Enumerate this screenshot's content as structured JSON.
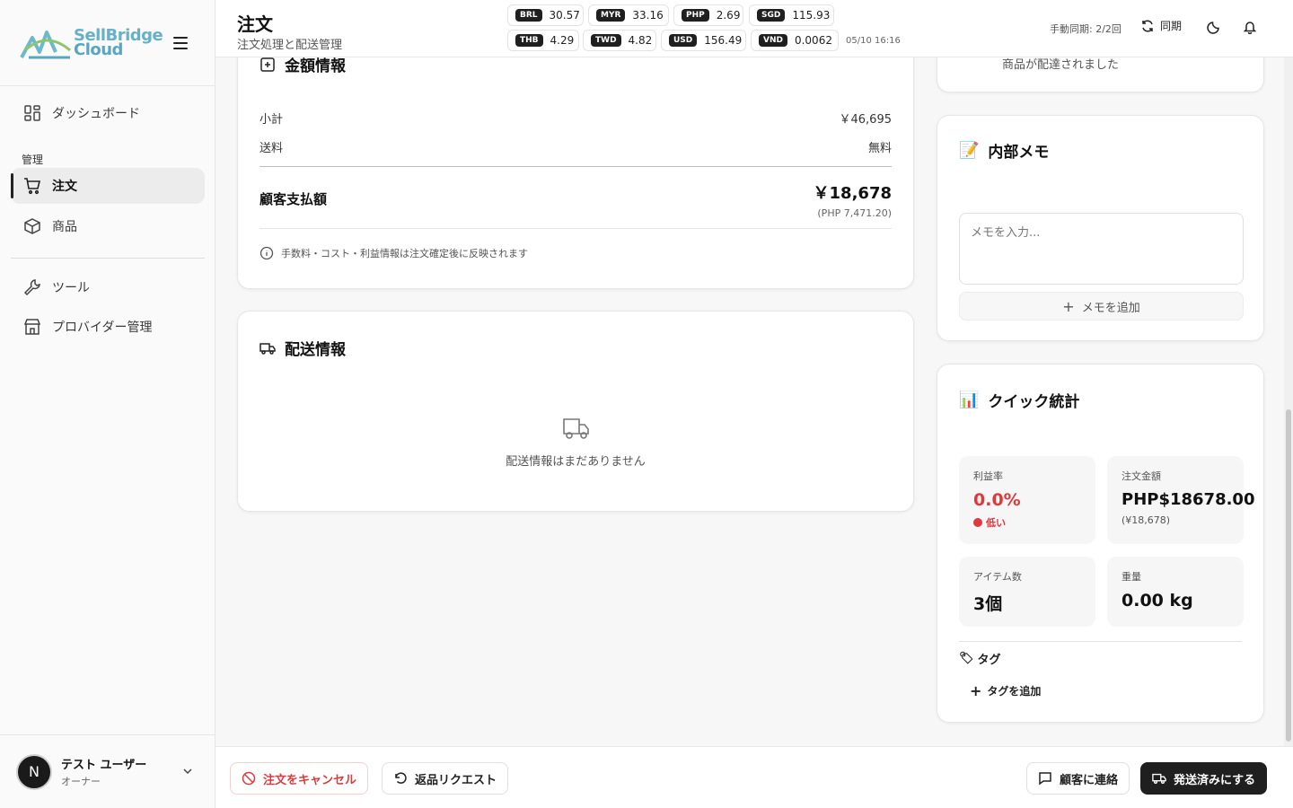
{
  "sidebar": {
    "logo": {
      "line1": "SellBridge",
      "line2": "Cloud"
    },
    "items": [
      {
        "label": "ダッシュボード",
        "icon": "dashboard-grid-icon"
      },
      {
        "label": "注文",
        "icon": "cart-icon",
        "active": true
      },
      {
        "label": "商品",
        "icon": "box-icon"
      },
      {
        "label": "ツール",
        "icon": "wrench-icon"
      },
      {
        "label": "プロバイダー管理",
        "icon": "store-icon"
      }
    ],
    "section_label": "管理",
    "user": {
      "initial": "N",
      "name": "テスト ユーザー",
      "role": "オーナー"
    }
  },
  "header": {
    "title": "注文",
    "subtitle": "注文処理と配送管理",
    "rates": [
      {
        "code": "BRL",
        "value": "30.57"
      },
      {
        "code": "MYR",
        "value": "33.16"
      },
      {
        "code": "PHP",
        "value": "2.69"
      },
      {
        "code": "SGD",
        "value": "115.93"
      },
      {
        "code": "THB",
        "value": "4.29"
      },
      {
        "code": "TWD",
        "value": "4.82"
      },
      {
        "code": "USD",
        "value": "156.49"
      },
      {
        "code": "VND",
        "value": "0.0062"
      }
    ],
    "rate_time": "05/10 16:16",
    "sync_count": "手動同期: 2/2回",
    "sync_label": "同期"
  },
  "amount_card": {
    "title": "金額情報",
    "subtotal_label": "小計",
    "subtotal_value": "￥46,695",
    "shipping_label": "送料",
    "shipping_value": "無料",
    "paid_label": "顧客支払額",
    "paid_value": "￥18,678",
    "paid_sub": "(PHP 7,471.20)",
    "note": "手数料・コスト・利益情報は注文確定後に反映されます"
  },
  "shipping_card": {
    "title": "配送情報",
    "empty": "配送情報はまだありません"
  },
  "timeline_partial": {
    "text": "商品が配達されました"
  },
  "memo_card": {
    "title": "内部メモ",
    "placeholder": "メモを入力...",
    "add_label": "メモを追加"
  },
  "stats_card": {
    "title": "クイック統計",
    "profit_label": "利益率",
    "profit_value": "0.0%",
    "profit_status": "低い",
    "order_label": "注文金額",
    "order_value": "PHP$18678.00",
    "order_sub": "(¥18,678)",
    "items_label": "アイテム数",
    "items_value": "3個",
    "weight_label": "重量",
    "weight_value": "0.00 kg",
    "tags_label": "タグ",
    "add_tag_label": "タグを追加"
  },
  "footer": {
    "cancel": "注文をキャンセル",
    "return": "返品リクエスト",
    "contact": "顧客に連絡",
    "ship": "発送済みにする"
  },
  "colors": {
    "danger": "#e0393c",
    "dark": "#1f1f1f"
  }
}
